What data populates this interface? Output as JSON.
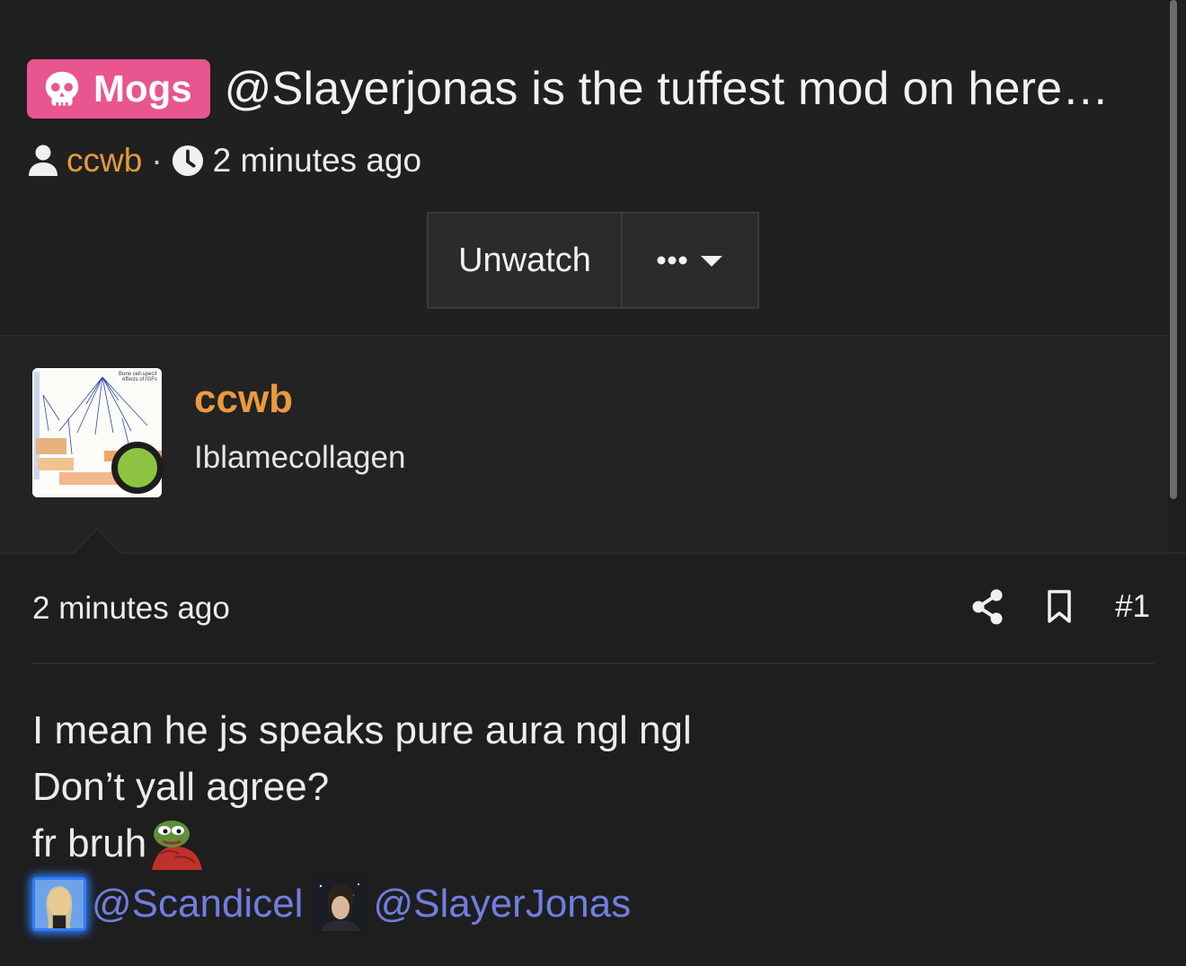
{
  "thread": {
    "tag": "Mogs",
    "title": "@Slayerjonas is the tuffest mod on here…",
    "author": "ccwb",
    "separator": "·",
    "time": "2 minutes ago"
  },
  "actions": {
    "unwatch_label": "Unwatch",
    "more_label": "•••"
  },
  "poster": {
    "username": "ccwb",
    "user_title": "Iblamecollagen",
    "status": "online",
    "status_color": "#8cc441"
  },
  "post": {
    "time": "2 minutes ago",
    "number": "#1",
    "lines": [
      "I mean he js speaks pure aura ngl ngl",
      "Don’t yall agree?",
      "fr bruh"
    ],
    "mentions": [
      "@Scandicel",
      "@SlayerJonas"
    ]
  },
  "colors": {
    "tag_bg": "#e8558f",
    "author": "#e79a3b",
    "mention": "#6f7ee0",
    "background": "#1e1e1f"
  },
  "icons": {
    "tag": "skull-icon",
    "author": "user-icon",
    "time": "clock-icon",
    "more": "caret-down-icon",
    "share": "share-icon",
    "bookmark": "bookmark-icon",
    "emoji": "pepe-emoji"
  }
}
